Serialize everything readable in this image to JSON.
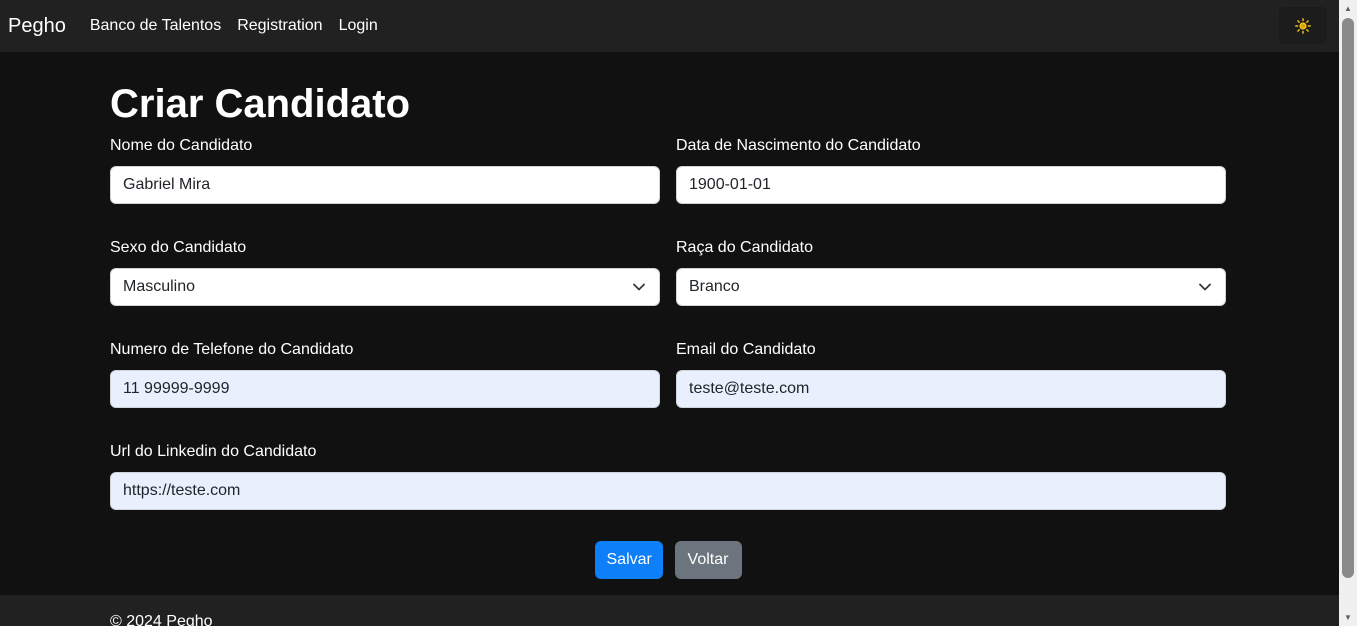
{
  "navbar": {
    "brand": "Pegho",
    "links": [
      "Banco de Talentos",
      "Registration",
      "Login"
    ],
    "theme_icon": "sun-icon"
  },
  "page": {
    "title": "Criar Candidato"
  },
  "form": {
    "name": {
      "label": "Nome do Candidato",
      "value": "Gabriel Mira"
    },
    "birthdate": {
      "label": "Data de Nascimento do Candidato",
      "value": "1900-01-01"
    },
    "sex": {
      "label": "Sexo do Candidato",
      "value": "Masculino"
    },
    "race": {
      "label": "Raça do Candidato",
      "value": "Branco"
    },
    "phone": {
      "label": "Numero de Telefone do Candidato",
      "value": "11 99999-9999"
    },
    "email": {
      "label": "Email do Candidato",
      "value": "teste@teste.com"
    },
    "linkedin": {
      "label": "Url do Linkedin do Candidato",
      "value": "https://teste.com"
    }
  },
  "buttons": {
    "save": "Salvar",
    "back": "Voltar"
  },
  "footer": {
    "text": "© 2024 Pegho"
  },
  "colors": {
    "background": "#111111",
    "navbar": "#212121",
    "primary": "#0d7ff8",
    "secondary": "#6c757d",
    "autofill": "#e8f0fe"
  }
}
